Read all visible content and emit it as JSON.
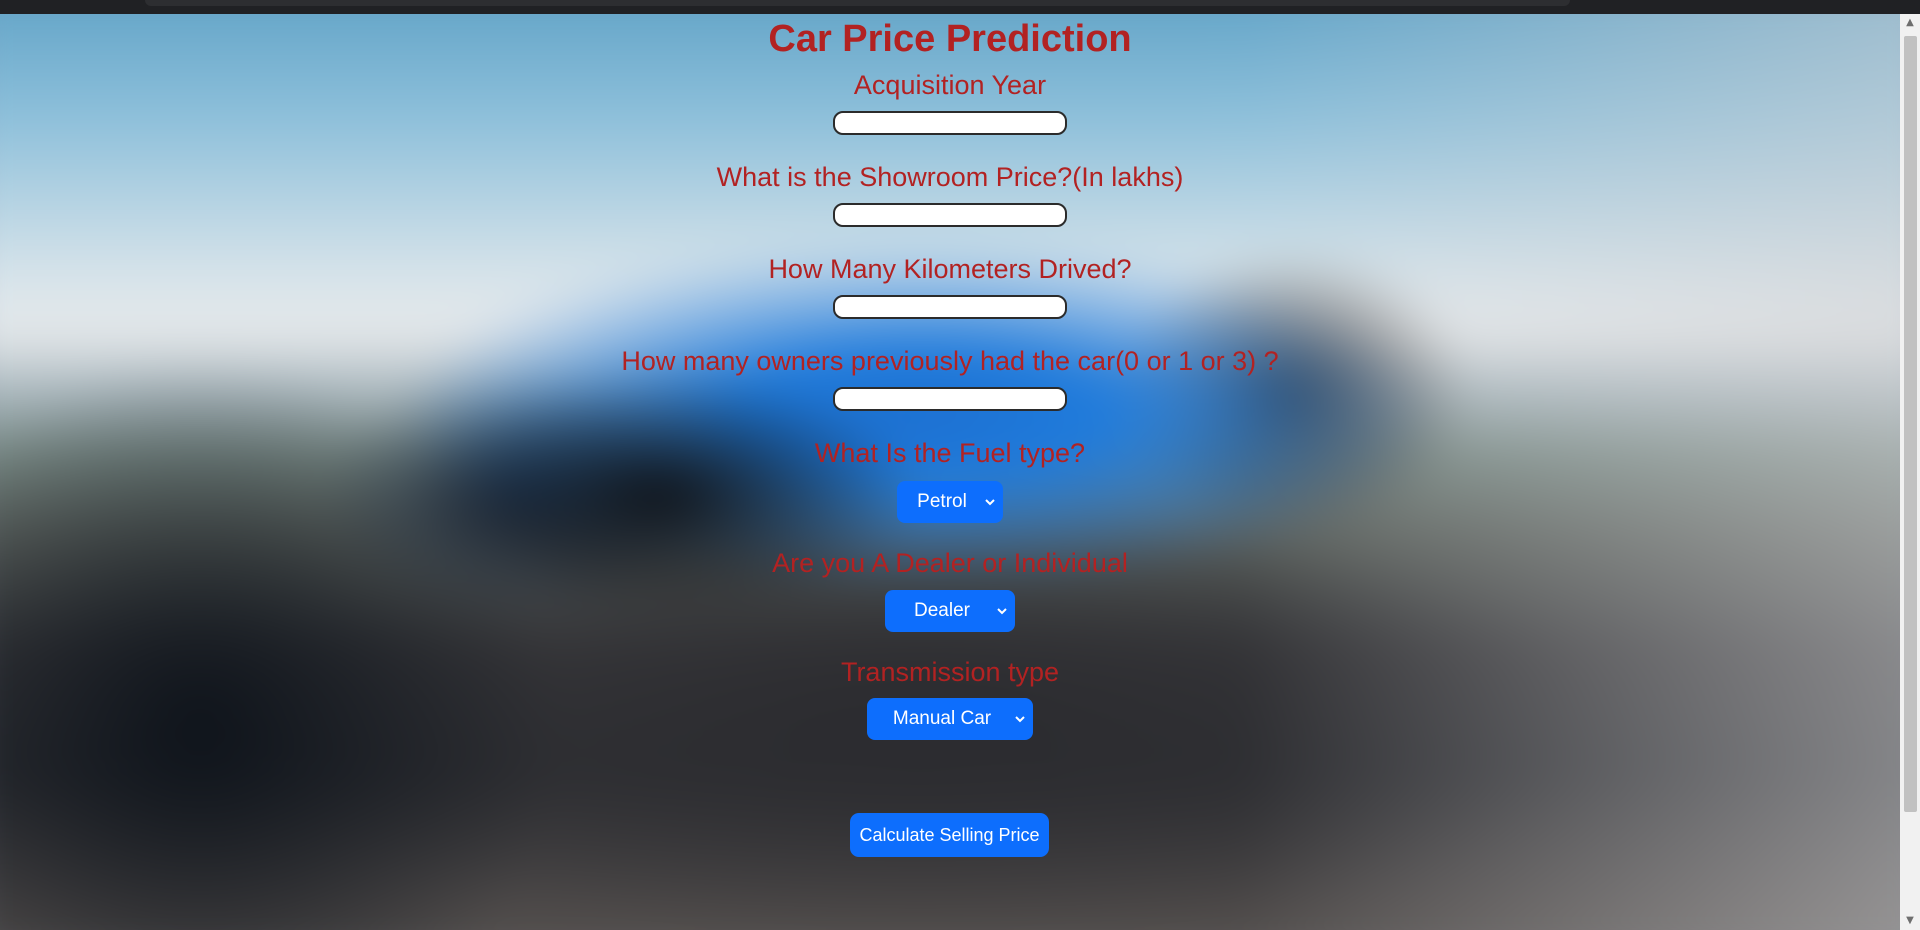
{
  "page": {
    "title": "Car Price Prediction"
  },
  "form": {
    "year_label": "Acquisition Year",
    "year_value": "",
    "price_label": "What is the Showroom Price?(In lakhs)",
    "price_value": "",
    "kms_label": "How Many Kilometers Drived?",
    "kms_value": "",
    "owners_label": "How many owners previously had the car(0 or 1 or 3) ?",
    "owners_value": "",
    "fuel_label": "What Is the Fuel type?",
    "fuel_selected": "Petrol",
    "seller_label": "Are you A Dealer or Individual",
    "seller_selected": "Dealer",
    "transmission_label": "Transmission type",
    "transmission_selected": "Manual Car",
    "submit_label": "Calculate Selling Price"
  },
  "icons": {
    "select_chevron": "chevron-down-icon",
    "scroll_up": "scroll-up-arrow",
    "scroll_down": "scroll-down-arrow"
  },
  "colors": {
    "heading": "#b22222",
    "accent": "#0d6efd",
    "field_border": "#2b2b2b"
  }
}
